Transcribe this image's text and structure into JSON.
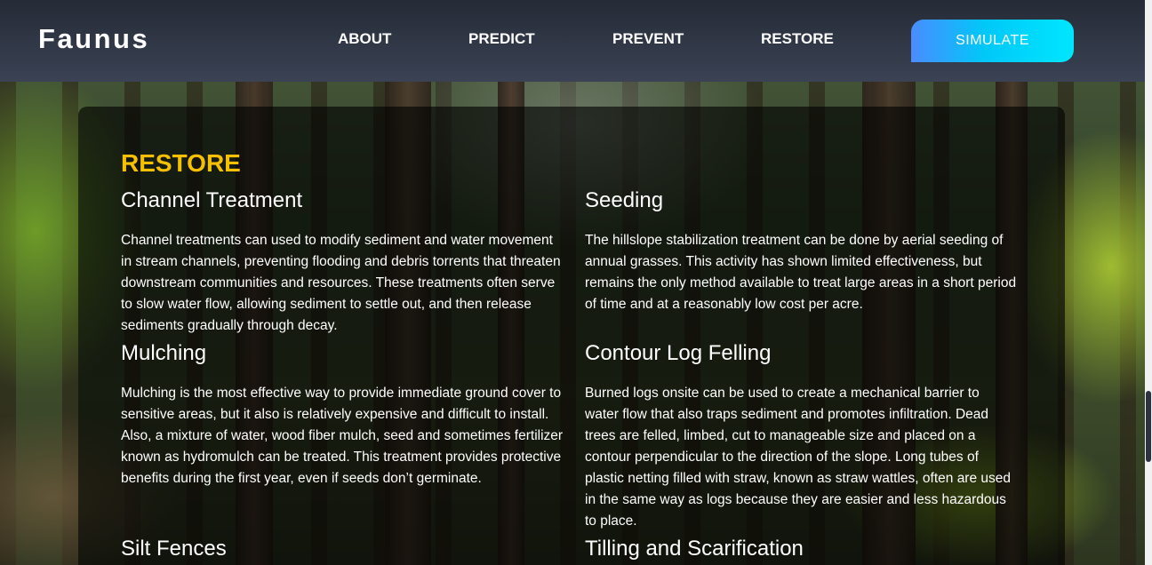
{
  "header": {
    "brand": "Faunus",
    "nav": [
      "ABOUT",
      "PREDICT",
      "PREVENT",
      "RESTORE"
    ],
    "cta_label": "SIMULATE"
  },
  "main": {
    "section_title": "RESTORE",
    "cards": [
      {
        "title": "Channel Treatment",
        "text": "Channel treatments can used to modify sediment and water movement in stream channels, preventing flooding and debris torrents that threaten downstream communities and resources. These treatments often serve to slow water flow, allowing sediment to settle out, and then release sediments gradually through decay."
      },
      {
        "title": "Seeding",
        "text": "The hillslope stabilization treatment can be done by aerial seeding of annual grasses. This activity has shown limited effectiveness, but remains the only method available to treat large areas in a short period of time and at a reasonably low cost per acre."
      },
      {
        "title": "Mulching",
        "text": "Mulching is the most effective way to provide immediate ground cover to sensitive areas, but it also is relatively expensive and difficult to install. Also, a mixture of water, wood fiber mulch, seed and sometimes fertilizer known as hydromulch can be treated. This treatment provides protective benefits during the first year, even if seeds don’t germinate."
      },
      {
        "title": "Contour Log Felling",
        "text": "Burned logs onsite can be used to create a mechanical barrier to water flow that also traps sediment and promotes infiltration. Dead trees are felled, limbed, cut to manageable size and placed on a contour perpendicular to the direction of the slope. Long tubes of plastic netting filled with straw, known as straw wattles, often are used in the same way as logs because they are easier and less hazardous to place."
      },
      {
        "title": "Silt Fences",
        "text": ""
      },
      {
        "title": "Tilling and Scarification",
        "text": ""
      }
    ]
  },
  "colors": {
    "accent": "#f5c000",
    "cta_gradient_start": "#4a8cff",
    "cta_gradient_end": "#00e6ff",
    "header_bg": "#2d3442"
  }
}
